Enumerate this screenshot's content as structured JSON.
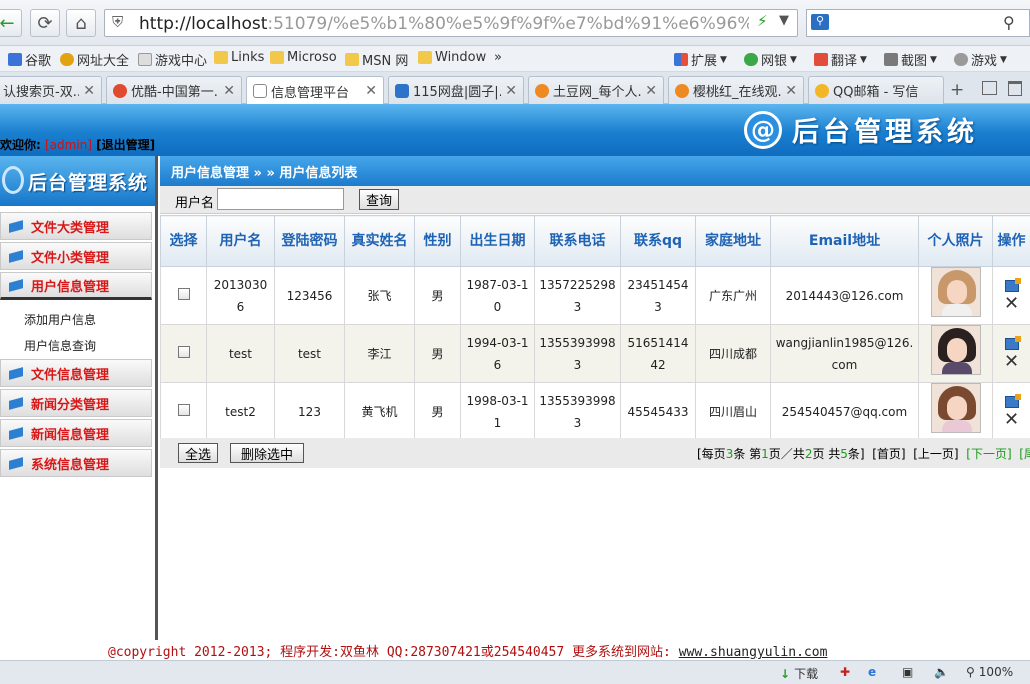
{
  "browser": {
    "url_host": "http://localhost",
    "url_rest": ":51079/%e5%b1%80%e5%9f%9f%e7%bd%91%e6%96%87%e4%bb%",
    "bookmarks": [
      "谷歌",
      "网址大全",
      "游戏中心",
      "Links",
      "Microso",
      "MSN 网",
      "Window",
      "»",
      "扩展",
      "网银",
      "翻译",
      "截图",
      "游戏"
    ],
    "tabs": [
      {
        "label": "认搜索页-双..."
      },
      {
        "label": "优酷-中国第一..."
      },
      {
        "label": "信息管理平台"
      },
      {
        "label": "115网盘|圆子|..."
      },
      {
        "label": "土豆网_每个人..."
      },
      {
        "label": "樱桃红_在线观..."
      },
      {
        "label": "QQ邮箱 - 写信"
      }
    ],
    "status": {
      "download": "下载",
      "zoom": "100%"
    }
  },
  "header": {
    "welcome": "欢迎你:",
    "user": "[admin]",
    "logout": "[退出管理]",
    "brand_mark": "@",
    "brand": "后台管理系统"
  },
  "sidebar": {
    "title": "后台管理系统",
    "menus": [
      "文件大类管理",
      "文件小类管理",
      "用户信息管理",
      "文件信息管理",
      "新闻分类管理",
      "新闻信息管理",
      "系统信息管理"
    ],
    "submenu": [
      "添加用户信息",
      "用户信息查询"
    ]
  },
  "content": {
    "breadcrumb": "用户信息管理 » » 用户信息列表",
    "search_label": "用户名",
    "search_button": "查询",
    "columns": [
      "选择",
      "用户名",
      "登陆密码",
      "真实姓名",
      "性别",
      "出生日期",
      "联系电话",
      "联系qq",
      "家庭地址",
      "Email地址",
      "个人照片",
      "操作"
    ],
    "rows": [
      {
        "username": "20130306",
        "password": "123456",
        "name": "张飞",
        "gender": "男",
        "birthday": "1987-03-10",
        "phone": "13572252983",
        "qq": "234514543",
        "address": "广东广州",
        "email": "2014443@126.com"
      },
      {
        "username": "test",
        "password": "test",
        "name": "李江",
        "gender": "男",
        "birthday": "1994-03-16",
        "phone": "13553939983",
        "qq": "5165141442",
        "address": "四川成都",
        "email": "wangjianlin1985@126.com"
      },
      {
        "username": "test2",
        "password": "123",
        "name": "黄飞机",
        "gender": "男",
        "birthday": "1998-03-11",
        "phone": "13553939983",
        "qq": "45545433",
        "address": "四川眉山",
        "email": "254540457@qq.com"
      }
    ],
    "select_all": "全选",
    "delete_selected": "删除选中",
    "pager": {
      "per_page": "3",
      "current": "1",
      "total_pages": "2",
      "total": "5",
      "first": "[首页]",
      "prev": "[上一页]",
      "next": "[下一页]",
      "last": "[尾页]"
    }
  },
  "footer": {
    "copyright": "@copyright 2012-2013; 程序开发:双鱼林  QQ:287307421或254540457  更多系统到网站: ",
    "site": "www.shuangyulin.com"
  }
}
